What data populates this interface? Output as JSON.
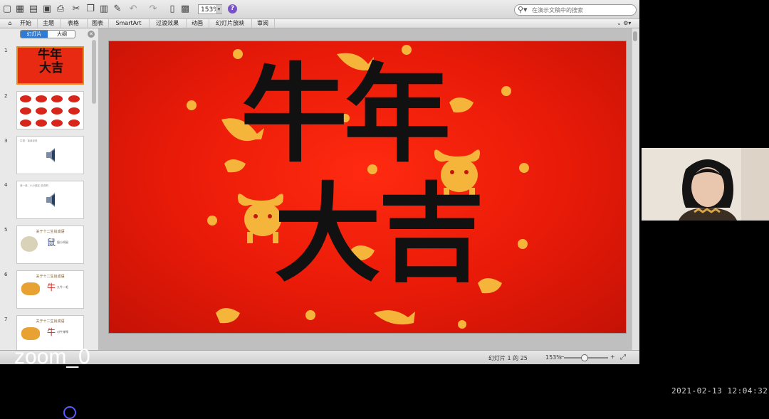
{
  "toolbar": {
    "zoom": "153%",
    "search_placeholder": "在演示文稿中的搜索",
    "icons": [
      "new-icon",
      "gallery-icon",
      "open-icon",
      "save-icon",
      "print-icon",
      "cut-icon",
      "copy-icon",
      "paste-icon",
      "format-icon",
      "undo-icon",
      "redo-icon",
      "slide-layout-icon",
      "slideshow-icon",
      "help-icon"
    ]
  },
  "ribbon": {
    "tabs": [
      "开始",
      "主题",
      "表格",
      "图表",
      "SmartArt",
      "过渡效果",
      "动画",
      "幻灯片放映",
      "审阅"
    ]
  },
  "sidebar": {
    "seg_slides": "幻灯片",
    "seg_outline": "大纲",
    "slides": [
      {
        "num": "1",
        "kind": "title"
      },
      {
        "num": "2",
        "kind": "oxen"
      },
      {
        "num": "3",
        "kind": "audio",
        "caption": "口语 · 读读说说"
      },
      {
        "num": "4",
        "kind": "audio",
        "caption": "读一读，小小朋友 说说吧"
      },
      {
        "num": "5",
        "kind": "zodiac",
        "title": "关于十二生肖成语",
        "char": "鼠",
        "sub": "胆小如鼠"
      },
      {
        "num": "6",
        "kind": "zodiac",
        "title": "关于十二生肖成语",
        "char": "牛",
        "sub": "九牛一毛"
      },
      {
        "num": "7",
        "kind": "zodiac",
        "title": "关于十二生肖成语",
        "char": "牛",
        "sub": "对牛弹琴"
      }
    ]
  },
  "slide": {
    "line1": [
      "牛",
      "年"
    ],
    "line2": [
      "大",
      "吉"
    ]
  },
  "status": {
    "page": "幻灯片 1 的 25",
    "zoom": "153%",
    "zoom_level_pct": 153
  },
  "overlay": {
    "participant": "zoom_0",
    "timestamp": "2021-02-13  12:04:32"
  },
  "colors": {
    "slide_red": "#e21b09",
    "gold": "#f5b43a",
    "calligraphy": "#111111"
  }
}
